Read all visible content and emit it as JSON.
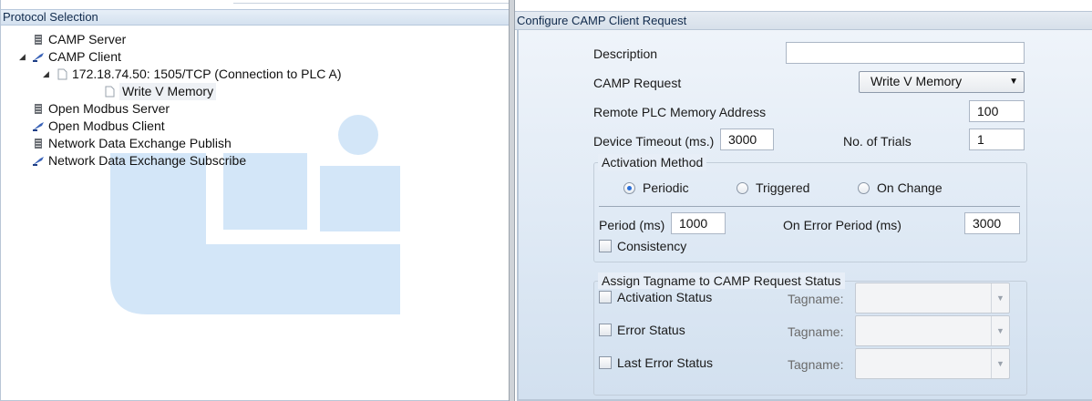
{
  "left_panel": {
    "header": "Protocol Selection",
    "tree": [
      {
        "label": "CAMP Server",
        "icon": "server-icon",
        "arrow": ""
      },
      {
        "label": "CAMP Client",
        "icon": "client-icon",
        "arrow": "◢"
      },
      {
        "label": "172.18.74.50: 1505/TCP (Connection to PLC A)",
        "icon": "document-icon",
        "arrow": "◢"
      },
      {
        "label": "Write V Memory",
        "icon": "document-icon",
        "arrow": ""
      },
      {
        "label": "Open Modbus Server",
        "icon": "server-icon",
        "arrow": ""
      },
      {
        "label": "Open Modbus Client",
        "icon": "client-icon",
        "arrow": ""
      },
      {
        "label": "Network Data Exchange Publish",
        "icon": "server-icon",
        "arrow": ""
      },
      {
        "label": "Network Data Exchange Subscribe",
        "icon": "client-icon",
        "arrow": ""
      }
    ]
  },
  "right_panel": {
    "header": "Configure CAMP Client Request",
    "description_label": "Description",
    "description_value": "",
    "camp_request_label": "CAMP Request",
    "camp_request_value": "Write V Memory",
    "remote_address_label": "Remote PLC Memory Address",
    "remote_address_value": "100",
    "device_timeout_label": "Device Timeout (ms.)",
    "device_timeout_value": "3000",
    "trials_label": "No. of Trials",
    "trials_value": "1",
    "activation": {
      "title": "Activation Method",
      "options": [
        "Periodic",
        "Triggered",
        "On Change"
      ],
      "selected": "Periodic",
      "period_label": "Period (ms)",
      "period_value": "1000",
      "error_period_label": "On Error Period (ms)",
      "error_period_value": "3000",
      "consistency_label": "Consistency"
    },
    "assign": {
      "title": "Assign Tagname to CAMP Request Status",
      "rows": [
        {
          "label": "Activation Status",
          "tag_label": "Tagname:"
        },
        {
          "label": "Error Status",
          "tag_label": "Tagname:"
        },
        {
          "label": "Last Error Status",
          "tag_label": "Tagname:"
        }
      ]
    }
  },
  "colors": {
    "header_text": "#102a4c",
    "watermark": "#cfe4f7",
    "radio_selected": "#2a6fd8"
  }
}
